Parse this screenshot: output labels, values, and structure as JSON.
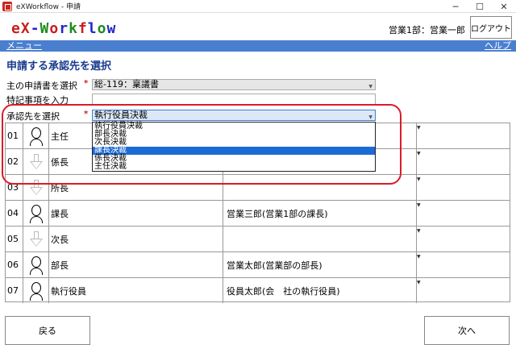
{
  "window": {
    "title": "eXWorkflow - 申請",
    "minimize": "─",
    "maximize": "☐",
    "close": "✕"
  },
  "header": {
    "logo": [
      "e",
      "X",
      "-",
      "W",
      "o",
      "r",
      "k",
      "f",
      "l",
      "o",
      "w"
    ],
    "user": "営業1部：営業一郎",
    "logout_label": "ログアウト"
  },
  "nav": {
    "menu_label": "メニュー",
    "help_label": "ヘルプ"
  },
  "page": {
    "title": "申請する承認先を選択"
  },
  "form": {
    "main_form_label": "主の申請書を選択",
    "main_form_value": "総-119：稟議書",
    "notes_label": "特記事項を入力",
    "notes_value": "",
    "approver_label": "承認先を選択",
    "approver_value": "執行役員決裁",
    "required_mark": "*"
  },
  "dropdown": {
    "options": [
      "執行役員決裁",
      "部長決裁",
      "次長決裁",
      "課長決裁",
      "係長決裁",
      "主任決裁"
    ],
    "selected_index": 3
  },
  "approval_rows": [
    {
      "no": "01",
      "icon": "person-icon",
      "role": "主任",
      "person": ""
    },
    {
      "no": "02",
      "icon": "down-arrow-icon",
      "role": "係長",
      "person": ""
    },
    {
      "no": "03",
      "icon": "down-arrow-icon",
      "role": "所長",
      "person": ""
    },
    {
      "no": "04",
      "icon": "person-icon",
      "role": "課長",
      "person": "営業三郎(営業1部の課長)"
    },
    {
      "no": "05",
      "icon": "down-arrow-icon",
      "role": "次長",
      "person": ""
    },
    {
      "no": "06",
      "icon": "person-icon",
      "role": "部長",
      "person": "営業太郎(営業部の部長)"
    },
    {
      "no": "07",
      "icon": "person-icon",
      "role": "執行役員",
      "person": "役員太郎(会　社の執行役員)"
    }
  ],
  "buttons": {
    "back_label": "戻る",
    "next_label": "次へ"
  },
  "colors": {
    "nav_bg": "#4a7fd0",
    "title_color": "#1a3c8f",
    "highlight": "#d91c2a",
    "selection": "#1c6bd4"
  }
}
